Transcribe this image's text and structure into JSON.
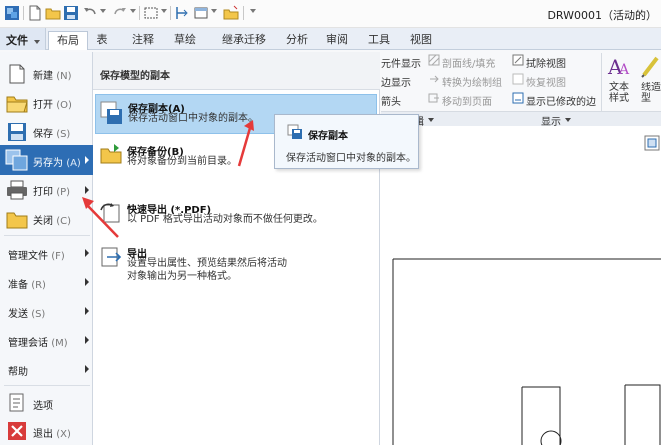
{
  "window": {
    "title": "DRW0001（活动的）"
  },
  "file_tab": {
    "label": "文件"
  },
  "tabs": [
    "布局",
    "表",
    "注释",
    "草绘",
    "继承迁移",
    "分析",
    "审阅",
    "工具",
    "视图"
  ],
  "ribbon": {
    "display_items": [
      "元件显示",
      "边显示",
      "箭头"
    ],
    "edit_items": [
      "剖面线/填充",
      "转换为绘制组",
      "移动到页面"
    ],
    "view_items": [
      "拭除视图",
      "恢复视图",
      "显示已修改的边"
    ],
    "big_buttons": [
      "文本样式",
      "线造型"
    ],
    "groups": {
      "edit": "编辑",
      "display": "显示"
    }
  },
  "file_menu": {
    "items": [
      {
        "label": "新建",
        "hotkey": "(N)",
        "submenu": false
      },
      {
        "label": "打开",
        "hotkey": "(O)",
        "submenu": false
      },
      {
        "label": "保存",
        "hotkey": "(S)",
        "submenu": false
      },
      {
        "label": "另存为",
        "hotkey": "(A)",
        "submenu": true
      },
      {
        "label": "打印",
        "hotkey": "(P)",
        "submenu": true
      },
      {
        "label": "关闭",
        "hotkey": "(C)",
        "submenu": false
      },
      {
        "label": "管理文件",
        "hotkey": "(F)",
        "submenu": true
      },
      {
        "label": "准备",
        "hotkey": "(R)",
        "submenu": true
      },
      {
        "label": "发送",
        "hotkey": "(S)",
        "submenu": true
      },
      {
        "label": "管理会话",
        "hotkey": "(M)",
        "submenu": true
      },
      {
        "label": "帮助",
        "hotkey": "",
        "submenu": true
      },
      {
        "label": "选项",
        "hotkey": "",
        "submenu": false
      },
      {
        "label": "退出",
        "hotkey": "(X)",
        "submenu": false
      }
    ]
  },
  "save_panel": {
    "header": "保存模型的副本",
    "items": [
      {
        "title": "保存副本(A)",
        "desc": [
          "保存活动窗口中对象的副本。"
        ]
      },
      {
        "title": "保存备份(B)",
        "desc": [
          "将对象备份到当前目录。"
        ]
      },
      {
        "title": "快速导出 (*.PDF)",
        "desc": [
          "以 PDF 格式导出活动对象而不做任何更改。"
        ]
      },
      {
        "title": "导出",
        "desc": [
          "设置导出属性、预览结果然后将活动",
          "对象输出为另一种格式。"
        ]
      }
    ]
  },
  "tooltip": {
    "title": "保存副本",
    "desc": "保存活动窗口中对象的副本。"
  },
  "colors": {
    "highlight": "#b3d7f3",
    "ribbon_bg": "#f7f8fa",
    "arrow": "#e53a3a"
  }
}
